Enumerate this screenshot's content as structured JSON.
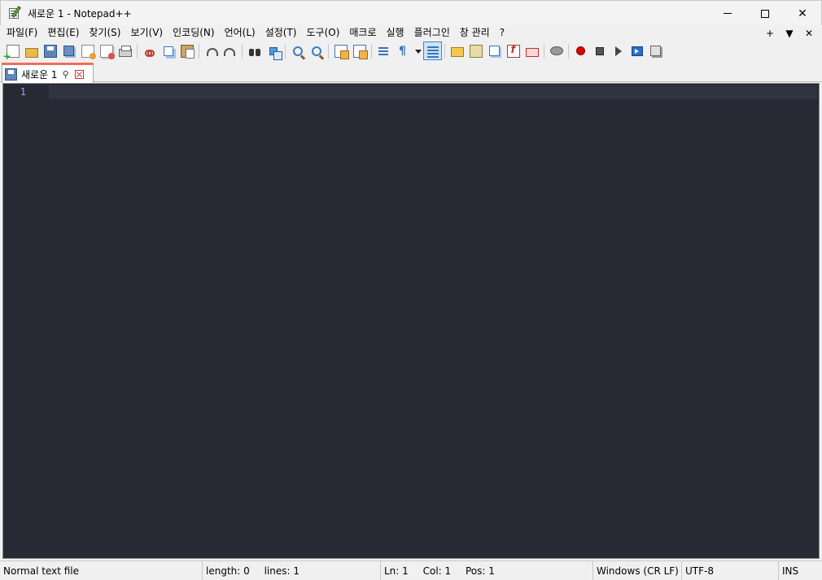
{
  "window": {
    "title": "새로운 1 - Notepad++",
    "controls": {
      "minimize": "–",
      "maximize": "☐",
      "close": "✕"
    }
  },
  "menu": {
    "items": [
      "파일(F)",
      "편집(E)",
      "찾기(S)",
      "보기(V)",
      "인코딩(N)",
      "언어(L)",
      "설정(T)",
      "도구(O)",
      "매크로",
      "실행",
      "플러그인",
      "창 관리",
      "?"
    ],
    "right": {
      "plus": "+",
      "down": "▼",
      "close": "✕"
    }
  },
  "toolbar": {
    "icons": [
      "new-file-icon",
      "open-file-icon",
      "save-icon",
      "save-all-icon",
      "close-icon",
      "close-all-icon",
      "print-icon",
      "cut-icon",
      "copy-icon",
      "paste-icon",
      "undo-icon",
      "redo-icon",
      "find-icon",
      "replace-icon",
      "zoom-in-icon",
      "zoom-out-icon",
      "sync-vertical-icon",
      "sync-horizontal-icon",
      "word-wrap-icon",
      "show-all-chars-icon",
      "dropdown-icon",
      "indent-guide-icon",
      "user-defined-lang-icon",
      "document-map-icon",
      "document-list-icon",
      "function-list-icon",
      "folder-as-workspace-icon",
      "monitoring-icon",
      "record-macro-icon",
      "stop-macro-icon",
      "play-macro-icon",
      "run-macro-multiple-icon",
      "save-macro-icon"
    ],
    "pilcrow": "¶"
  },
  "tab": {
    "label": "새로운 1",
    "pin": "⚲"
  },
  "editor": {
    "line_number": "1",
    "background": "#272a35",
    "line_number_color": "#a99df2"
  },
  "status": {
    "file_type": "Normal text file",
    "length": "length: 0",
    "lines": "lines: 1",
    "ln": "Ln: 1",
    "col": "Col: 1",
    "pos": "Pos: 1",
    "eol": "Windows (CR LF)",
    "encoding": "UTF-8",
    "mode": "INS"
  },
  "colors": {
    "tab_accent": "#f36c5a",
    "active_button": "#cce4f7"
  }
}
